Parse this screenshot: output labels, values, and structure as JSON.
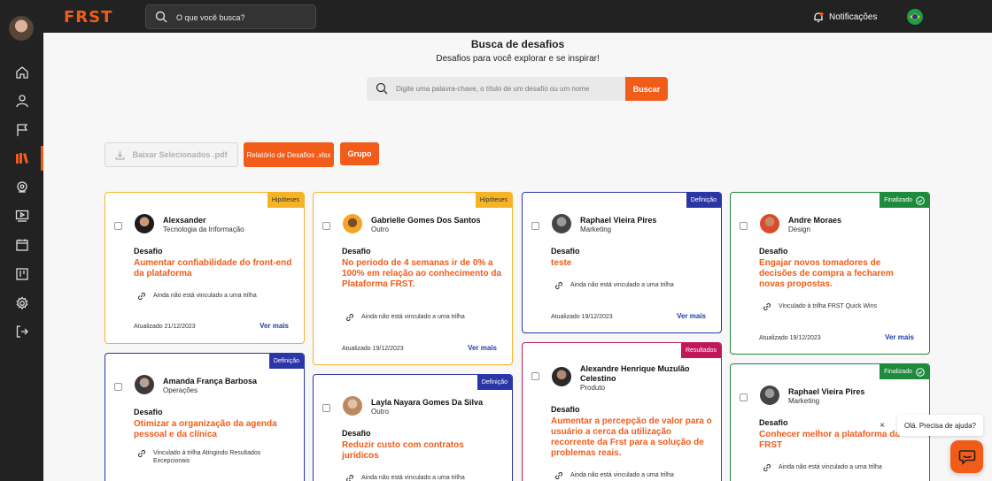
{
  "app": {
    "logo": "FRST"
  },
  "topbar": {
    "search_placeholder": "O que você busca?",
    "notifications_label": "Notificações"
  },
  "header": {
    "title": "Busca de desafios",
    "subtitle": "Desafios para você explorar e se inspirar!"
  },
  "search": {
    "placeholder": "Digite uma palavra-chave, o título de um desafio ou um nome",
    "button": "Buscar"
  },
  "actions": {
    "download_pdf": "Baixar Selecionados .pdf",
    "report_xlsx": "Relatório de Desafios .xlsx",
    "group": "Grupo"
  },
  "colors": {
    "accent": "#f25c19",
    "hipoteses": "#f5b325",
    "definicao": "#2b36a6",
    "finalizado": "#1e8a3c",
    "resultados": "#c2185b",
    "link": "#1f3fa8"
  },
  "challenge_label": "Desafio",
  "see_more": "Ver mais",
  "cards": [
    {
      "user": "Alexsander",
      "area": "Tecnologia da Informação",
      "status": "Hipóteses",
      "title": "Aumentar confiabilidade do front-end da plataforma",
      "trail": "Ainda não está vinculado a uma trilha",
      "updated": "Atualizado 21/12/2023"
    },
    {
      "user": "Gabrielle Gomes Dos Santos",
      "area": "Outro",
      "status": "Hipóteses",
      "title": "No periodo de 4 semanas ir de 0% a 100% em relação ao conhecimento da Plataforma FRST.",
      "trail": "Ainda não está vinculado a uma trilha",
      "updated": "Atualizado 19/12/2023"
    },
    {
      "user": "Raphael Vieira Pires",
      "area": "Marketing",
      "status": "Definição",
      "title": "teste",
      "trail": "Ainda não está vinculado a uma trilha",
      "updated": "Atualizado 19/12/2023"
    },
    {
      "user": "Andre Moraes",
      "area": "Design",
      "status": "Finalizado",
      "title": "Engajar novos tomadores de decisões de compra a fecharem novas propostas.",
      "trail": "Vinculado à trilha FRST Quick Wins",
      "updated": "Atualizado 19/12/2023"
    },
    {
      "user": "Amanda França Barbosa",
      "area": "Operações",
      "status": "Definição",
      "title": "Otimizar a organização da agenda pessoal e da clínica",
      "trail": "Vinculado à trilha Atingindo Resultados Excepcionais"
    },
    {
      "user": "Layla Nayara Gomes Da Silva",
      "area": "Outro",
      "status": "Definição",
      "title": "Reduzir custo com contratos jurídicos",
      "trail": "Ainda não está vinculado a uma trilha"
    },
    {
      "user": "Alexandre Henrique Muzulão Celestino",
      "area": "Produto",
      "status": "Resultados",
      "title": "Aumentar a percepção de valor para o usuário a cerca da utilização recorrente da Frst para a solução de problemas reais.",
      "trail": "Ainda não está vinculado a uma trilha"
    },
    {
      "user": "Raphael Vieira Pires",
      "area": "Marketing",
      "status": "Finalizado",
      "title": "Conhecer melhor a plataforma da FRST",
      "trail": "Ainda não está vinculado a uma trilha"
    }
  ],
  "chat": {
    "greeting": "Olá. Precisa de ajuda?",
    "close": "×"
  },
  "icons": [
    "search-icon",
    "bell-icon",
    "home-icon",
    "user-icon",
    "flag-icon",
    "library-icon",
    "map-pin-icon",
    "video-icon",
    "calendar-icon",
    "board-icon",
    "gear-icon",
    "logout-icon",
    "download-icon",
    "link-icon",
    "check-circle-icon",
    "chat-icon"
  ]
}
